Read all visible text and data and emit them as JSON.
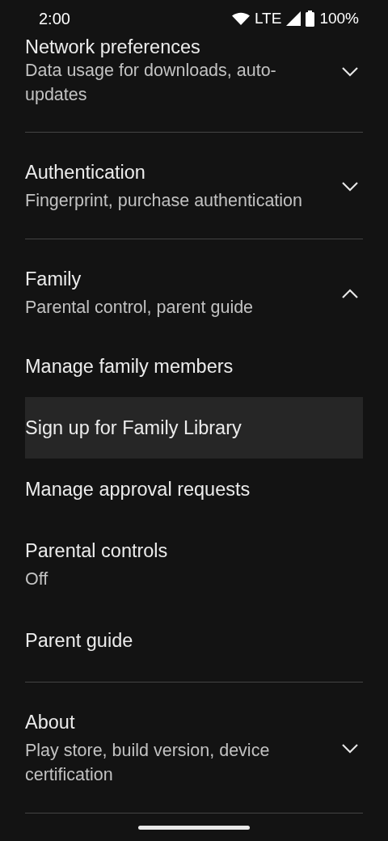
{
  "status_bar": {
    "time": "2:00",
    "network": "LTE",
    "battery": "100%"
  },
  "sections": [
    {
      "title": "Network preferences",
      "subtitle": "Data usage for downloads, auto-updates",
      "expanded": false
    },
    {
      "title": "Authentication",
      "subtitle": "Fingerprint, purchase authentication",
      "expanded": false
    },
    {
      "title": "Family",
      "subtitle": "Parental control, parent guide",
      "expanded": true,
      "children": [
        {
          "title": "Manage family members",
          "selected": false
        },
        {
          "title": "Sign up for Family Library",
          "selected": true
        },
        {
          "title": "Manage approval requests",
          "selected": false
        },
        {
          "title": "Parental controls",
          "subtitle": "Off",
          "selected": false
        },
        {
          "title": "Parent guide",
          "selected": false
        }
      ]
    },
    {
      "title": "About",
      "subtitle": "Play store, build version, device certification",
      "expanded": false
    }
  ]
}
